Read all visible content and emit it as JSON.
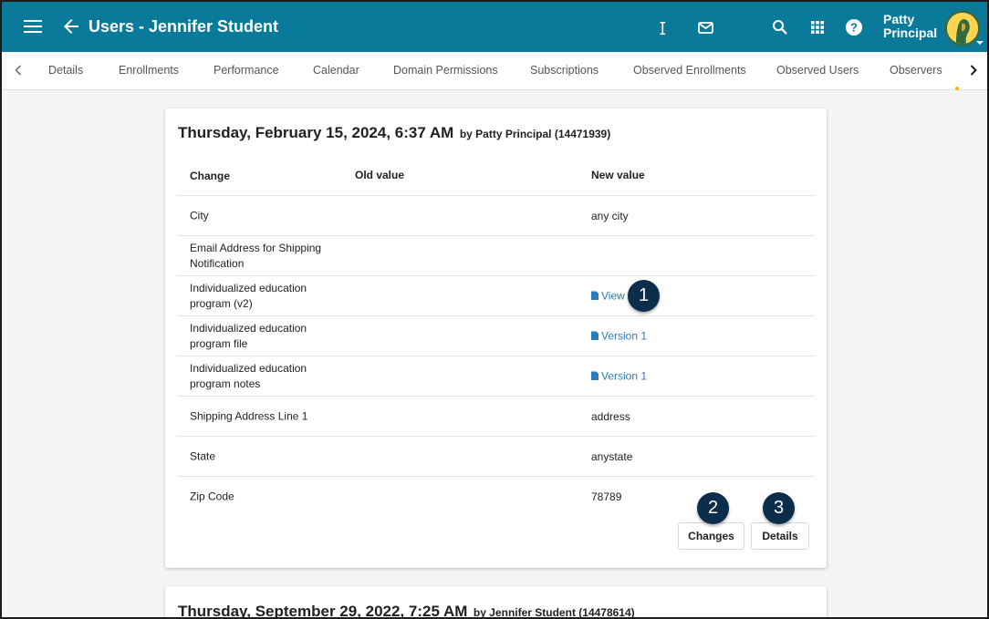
{
  "header": {
    "title": "Users - Jennifer Student",
    "user_first": "Patty",
    "user_last": "Principal",
    "icons": [
      "menu-icon",
      "back-arrow-icon",
      "cursor-icon",
      "mail-icon",
      "search-icon",
      "apps-grid-icon",
      "help-icon"
    ],
    "color": "#0a7a9a"
  },
  "tabs": [
    "Details",
    "Enrollments",
    "Performance",
    "Calendar",
    "Domain Permissions",
    "Subscriptions",
    "Observed Enrollments",
    "Observed Users",
    "Observers"
  ],
  "entry": {
    "date": "Thursday, February 15, 2024, 6:37 AM",
    "by": "by Patty Principal (14471939)",
    "columns": {
      "change": "Change",
      "old": "Old value",
      "new": "New value"
    },
    "rows": [
      {
        "change": "City",
        "old": "",
        "new": "any city",
        "link": false
      },
      {
        "change": "Email Address for Shipping Notification",
        "old": "",
        "new": "",
        "link": false
      },
      {
        "change": "Individualized education program (v2)",
        "old": "",
        "new": "View",
        "link": true
      },
      {
        "change": "Individualized education program file",
        "old": "",
        "new": "Version 1",
        "link": true
      },
      {
        "change": "Individualized education program notes",
        "old": "",
        "new": "Version 1",
        "link": true
      },
      {
        "change": "Shipping Address Line 1",
        "old": "",
        "new": "address",
        "link": false
      },
      {
        "change": "State",
        "old": "",
        "new": "anystate",
        "link": false
      },
      {
        "change": "Zip Code",
        "old": "",
        "new": "78789",
        "link": false
      }
    ],
    "buttons": {
      "changes": "Changes",
      "details": "Details"
    }
  },
  "entry2": {
    "date": "Thursday, September 29, 2022, 7:25 AM",
    "by": "by Jennifer Student (14478614)"
  },
  "callouts": [
    "1",
    "2",
    "3"
  ]
}
